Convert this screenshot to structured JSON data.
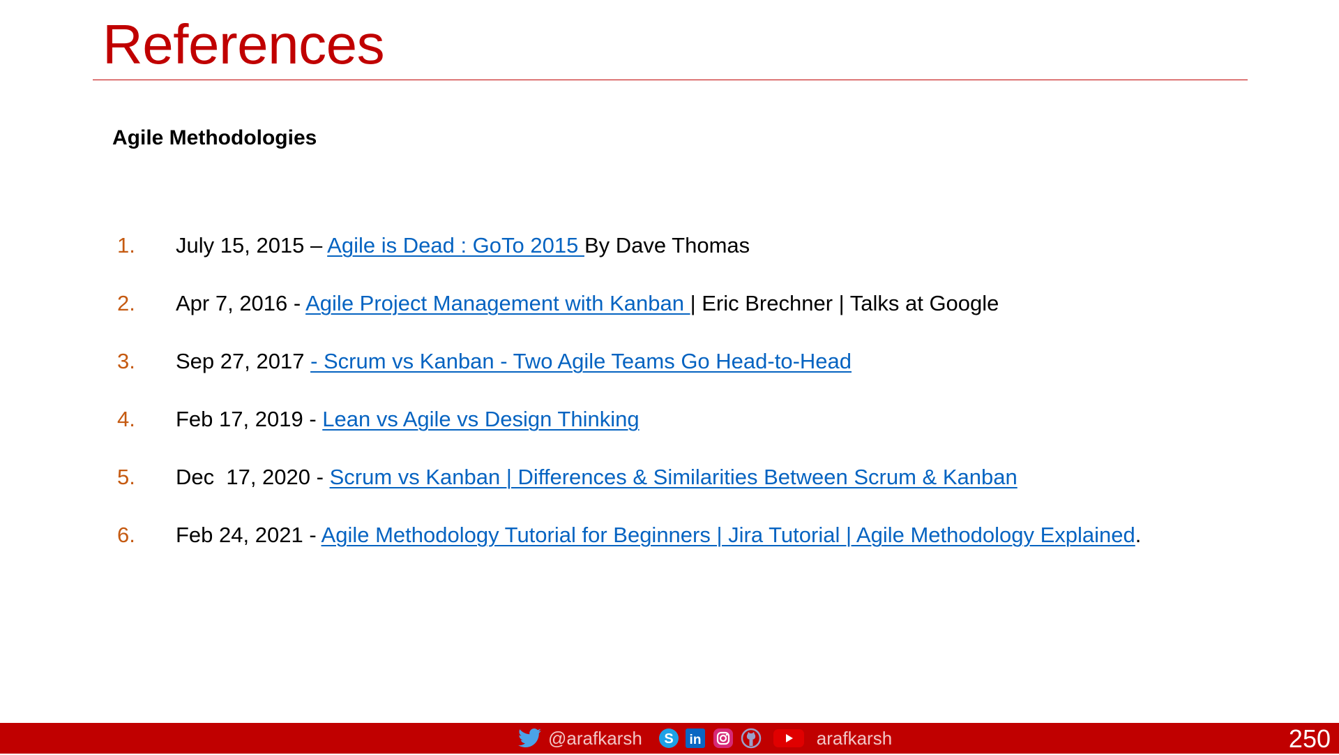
{
  "title": "References",
  "section_heading": "Agile Methodologies",
  "references": [
    {
      "number": "1.",
      "prefix": "July 15, 2015 – ",
      "link": "Agile is Dead : GoTo 2015 ",
      "suffix": "By Dave Thomas"
    },
    {
      "number": "2.",
      "prefix": "Apr 7, 2016 - ",
      "link": "Agile Project Management with Kanban ",
      "suffix": "| Eric Brechner | Talks at Google"
    },
    {
      "number": "3.",
      "prefix": "Sep 27, 2017 ",
      "link": "- Scrum vs Kanban - Two Agile Teams Go Head-to-Head",
      "suffix": ""
    },
    {
      "number": "4.",
      "prefix": "Feb 17, 2019 - ",
      "link": "Lean vs Agile vs Design Thinking",
      "suffix": ""
    },
    {
      "number": "5.",
      "prefix": "Dec  17, 2020 - ",
      "link": "Scrum vs Kanban | Differences & Similarities Between Scrum & Kanban ",
      "suffix": ""
    },
    {
      "number": "6.",
      "prefix": "Feb 24, 2021 - ",
      "link": "Agile Methodology Tutorial for Beginners | Jira Tutorial | Agile Methodology Explained",
      "suffix": "."
    }
  ],
  "footer": {
    "twitter_handle": "@arafkarsh",
    "youtube_handle": "arafkarsh",
    "icons": [
      "twitter-icon",
      "skype-icon",
      "linkedin-icon",
      "instagram-icon",
      "github-icon",
      "youtube-icon"
    ]
  },
  "page_number": "250",
  "colors": {
    "accent": "#c00000",
    "link": "#0563c1",
    "list_number": "#c55a11",
    "footer_text": "#f2c6c6"
  }
}
